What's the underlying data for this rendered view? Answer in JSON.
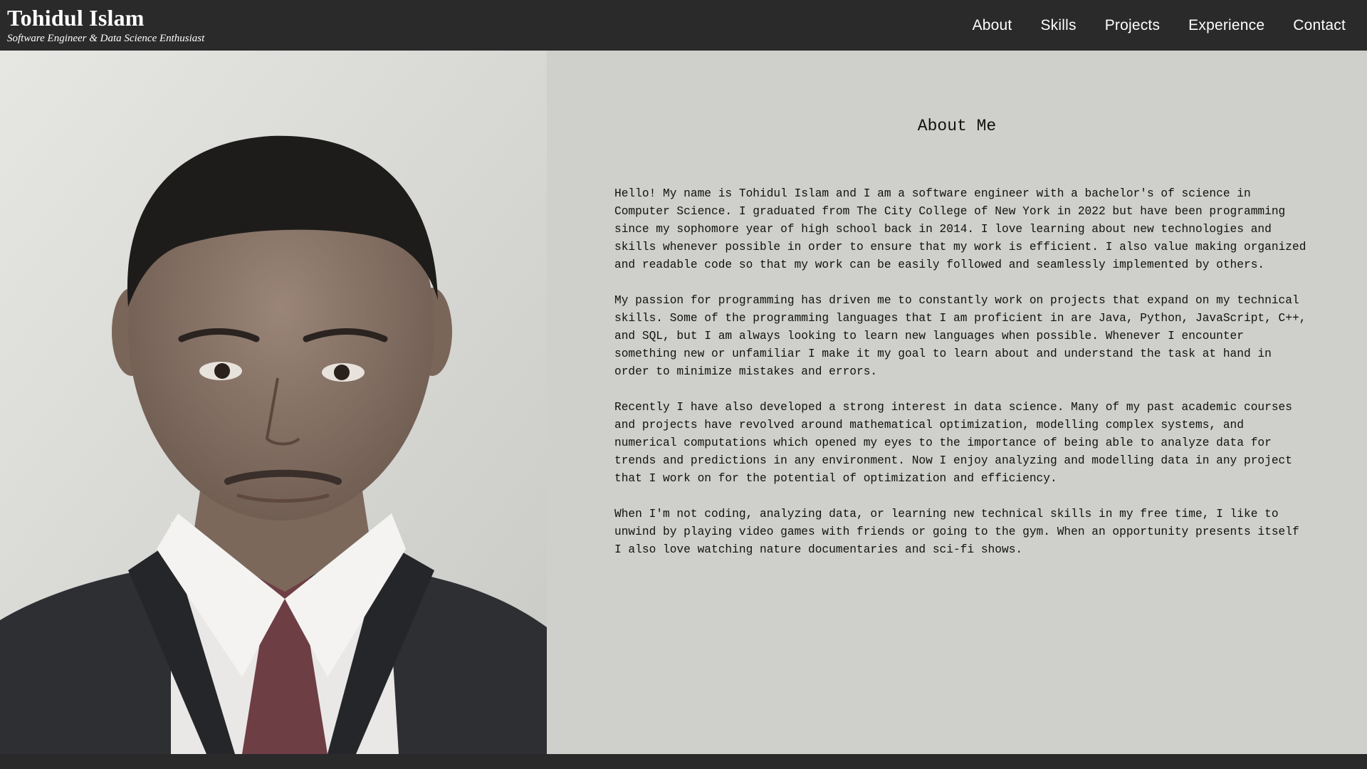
{
  "header": {
    "name": "Tohidul Islam",
    "tagline": "Software Engineer & Data Science Enthusiast",
    "nav": [
      "About",
      "Skills",
      "Projects",
      "Experience",
      "Contact"
    ]
  },
  "about": {
    "title": "About Me",
    "paragraphs": [
      "Hello! My name is Tohidul Islam and I am a software engineer with a bachelor's of science in Computer Science. I graduated from The City College of New York in 2022 but have been programming since my sophomore year of high school back in 2014. I love learning about new technologies and skills whenever possible in order to ensure that my work is efficient. I also value making organized and readable code so that my work can be easily followed and seamlessly implemented by others.",
      "My passion for programming has driven me to constantly work on projects that expand on my technical skills. Some of the programming languages that I am proficient in are Java, Python, JavaScript, C++, and SQL, but I am always looking to learn new languages when possible. Whenever I encounter something new or unfamiliar I make it my goal to learn about and understand the task at hand in order to minimize mistakes and errors.",
      "Recently I have also developed a strong interest in data science. Many of my past academic courses and projects have revolved around mathematical optimization, modelling complex systems, and numerical computations which opened my eyes to the importance of being able to analyze data for trends and predictions in any environment. Now I enjoy analyzing and modelling data in any project that I work on for the potential of optimization and efficiency.",
      "When I'm not coding, analyzing data, or learning new technical skills in my free time, I like to unwind by playing video games with friends or going to the gym. When an opportunity presents itself I also love watching nature documentaries and sci-fi shows."
    ]
  },
  "colors": {
    "header_bg": "#2a2a2a",
    "content_bg": "#cfcfcb",
    "text": "#111111"
  }
}
